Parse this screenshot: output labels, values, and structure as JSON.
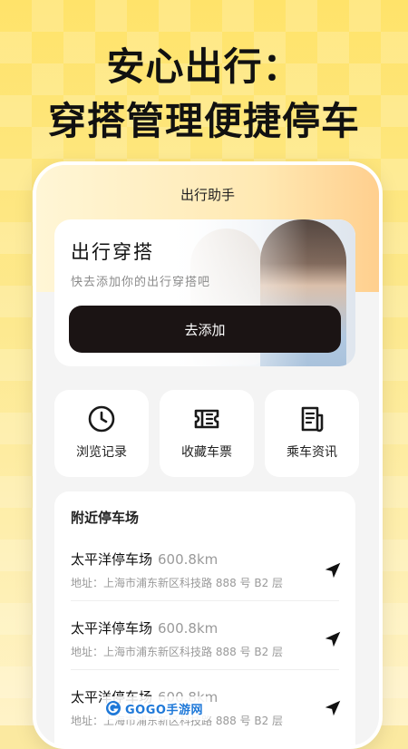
{
  "headline": {
    "line1": "安心出行：",
    "line2": "穿搭管理便捷停车"
  },
  "app": {
    "title": "出行助手"
  },
  "outfit_card": {
    "title": "出行穿搭",
    "subtitle": "快去添加你的出行穿搭吧",
    "button_label": "去添加"
  },
  "tiles": [
    {
      "label": "浏览记录",
      "icon": "clock-icon"
    },
    {
      "label": "收藏车票",
      "icon": "ticket-icon"
    },
    {
      "label": "乘车资讯",
      "icon": "news-icon"
    }
  ],
  "nearby": {
    "title": "附近停车场",
    "items": [
      {
        "name": "太平洋停车场",
        "distance": "600.8km",
        "address": "地址：上海市浦东新区科技路 888 号 B2 层"
      },
      {
        "name": "太平洋停车场",
        "distance": "600.8km",
        "address": "地址：上海市浦东新区科技路 888 号 B2 层"
      },
      {
        "name": "太平洋停车场",
        "distance": "600.8km",
        "address": "地址：上海市浦东新区科技路 888 号 B2 层"
      }
    ]
  },
  "watermark": {
    "text": "GOGO手游网"
  },
  "colors": {
    "button_dark": "#1b1414",
    "background_yellow": "#fde98f",
    "watermark_blue": "#1e78d8"
  }
}
